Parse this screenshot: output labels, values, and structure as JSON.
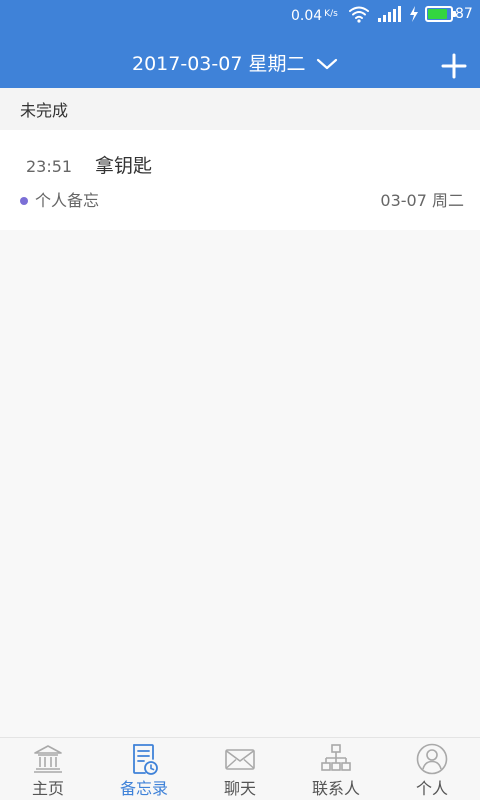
{
  "colors": {
    "primary": "#3f82d8",
    "active_tab": "#3f82d8",
    "category_dot": "#7b6fd6",
    "battery_fill": "#33d63f"
  },
  "status_bar": {
    "speed": "0.04",
    "speed_unit": "K/s",
    "battery_level": "87",
    "battery_percent": 87,
    "icons": [
      "wifi-icon",
      "signal-icon",
      "charging-icon",
      "battery-icon"
    ]
  },
  "header": {
    "date_label": "2017-03-07 星期二",
    "dropdown_icon": "chevron-down-icon",
    "add_icon": "plus-icon"
  },
  "section": {
    "title": "未完成"
  },
  "memos": [
    {
      "time": "23:51",
      "title": "拿钥匙",
      "category": "个人备忘",
      "date": "03-07 周二"
    }
  ],
  "tabs": [
    {
      "label": "主页",
      "icon": "bank-icon",
      "active": false
    },
    {
      "label": "备忘录",
      "icon": "memo-clock-icon",
      "active": true
    },
    {
      "label": "聊天",
      "icon": "envelope-icon",
      "active": false
    },
    {
      "label": "联系人",
      "icon": "org-chart-icon",
      "active": false
    },
    {
      "label": "个人",
      "icon": "user-icon",
      "active": false
    }
  ]
}
